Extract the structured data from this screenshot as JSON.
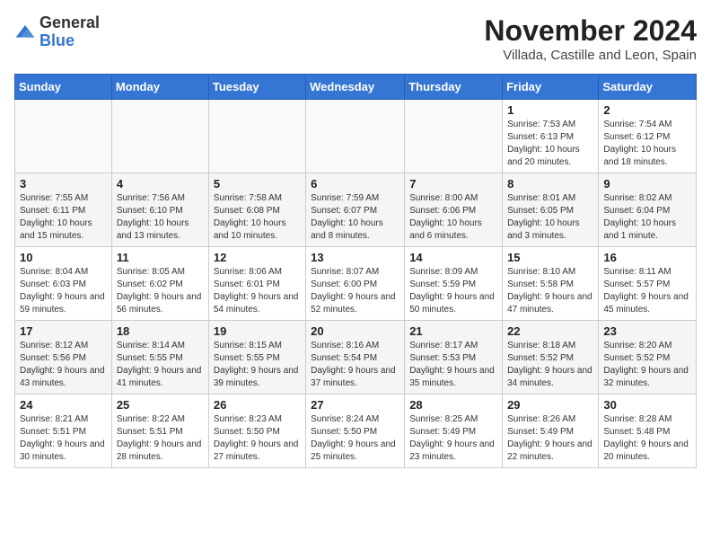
{
  "header": {
    "logo_general": "General",
    "logo_blue": "Blue",
    "month_title": "November 2024",
    "location": "Villada, Castille and Leon, Spain"
  },
  "weekdays": [
    "Sunday",
    "Monday",
    "Tuesday",
    "Wednesday",
    "Thursday",
    "Friday",
    "Saturday"
  ],
  "weeks": [
    [
      {
        "day": "",
        "info": ""
      },
      {
        "day": "",
        "info": ""
      },
      {
        "day": "",
        "info": ""
      },
      {
        "day": "",
        "info": ""
      },
      {
        "day": "",
        "info": ""
      },
      {
        "day": "1",
        "info": "Sunrise: 7:53 AM\nSunset: 6:13 PM\nDaylight: 10 hours and 20 minutes."
      },
      {
        "day": "2",
        "info": "Sunrise: 7:54 AM\nSunset: 6:12 PM\nDaylight: 10 hours and 18 minutes."
      }
    ],
    [
      {
        "day": "3",
        "info": "Sunrise: 7:55 AM\nSunset: 6:11 PM\nDaylight: 10 hours and 15 minutes."
      },
      {
        "day": "4",
        "info": "Sunrise: 7:56 AM\nSunset: 6:10 PM\nDaylight: 10 hours and 13 minutes."
      },
      {
        "day": "5",
        "info": "Sunrise: 7:58 AM\nSunset: 6:08 PM\nDaylight: 10 hours and 10 minutes."
      },
      {
        "day": "6",
        "info": "Sunrise: 7:59 AM\nSunset: 6:07 PM\nDaylight: 10 hours and 8 minutes."
      },
      {
        "day": "7",
        "info": "Sunrise: 8:00 AM\nSunset: 6:06 PM\nDaylight: 10 hours and 6 minutes."
      },
      {
        "day": "8",
        "info": "Sunrise: 8:01 AM\nSunset: 6:05 PM\nDaylight: 10 hours and 3 minutes."
      },
      {
        "day": "9",
        "info": "Sunrise: 8:02 AM\nSunset: 6:04 PM\nDaylight: 10 hours and 1 minute."
      }
    ],
    [
      {
        "day": "10",
        "info": "Sunrise: 8:04 AM\nSunset: 6:03 PM\nDaylight: 9 hours and 59 minutes."
      },
      {
        "day": "11",
        "info": "Sunrise: 8:05 AM\nSunset: 6:02 PM\nDaylight: 9 hours and 56 minutes."
      },
      {
        "day": "12",
        "info": "Sunrise: 8:06 AM\nSunset: 6:01 PM\nDaylight: 9 hours and 54 minutes."
      },
      {
        "day": "13",
        "info": "Sunrise: 8:07 AM\nSunset: 6:00 PM\nDaylight: 9 hours and 52 minutes."
      },
      {
        "day": "14",
        "info": "Sunrise: 8:09 AM\nSunset: 5:59 PM\nDaylight: 9 hours and 50 minutes."
      },
      {
        "day": "15",
        "info": "Sunrise: 8:10 AM\nSunset: 5:58 PM\nDaylight: 9 hours and 47 minutes."
      },
      {
        "day": "16",
        "info": "Sunrise: 8:11 AM\nSunset: 5:57 PM\nDaylight: 9 hours and 45 minutes."
      }
    ],
    [
      {
        "day": "17",
        "info": "Sunrise: 8:12 AM\nSunset: 5:56 PM\nDaylight: 9 hours and 43 minutes."
      },
      {
        "day": "18",
        "info": "Sunrise: 8:14 AM\nSunset: 5:55 PM\nDaylight: 9 hours and 41 minutes."
      },
      {
        "day": "19",
        "info": "Sunrise: 8:15 AM\nSunset: 5:55 PM\nDaylight: 9 hours and 39 minutes."
      },
      {
        "day": "20",
        "info": "Sunrise: 8:16 AM\nSunset: 5:54 PM\nDaylight: 9 hours and 37 minutes."
      },
      {
        "day": "21",
        "info": "Sunrise: 8:17 AM\nSunset: 5:53 PM\nDaylight: 9 hours and 35 minutes."
      },
      {
        "day": "22",
        "info": "Sunrise: 8:18 AM\nSunset: 5:52 PM\nDaylight: 9 hours and 34 minutes."
      },
      {
        "day": "23",
        "info": "Sunrise: 8:20 AM\nSunset: 5:52 PM\nDaylight: 9 hours and 32 minutes."
      }
    ],
    [
      {
        "day": "24",
        "info": "Sunrise: 8:21 AM\nSunset: 5:51 PM\nDaylight: 9 hours and 30 minutes."
      },
      {
        "day": "25",
        "info": "Sunrise: 8:22 AM\nSunset: 5:51 PM\nDaylight: 9 hours and 28 minutes."
      },
      {
        "day": "26",
        "info": "Sunrise: 8:23 AM\nSunset: 5:50 PM\nDaylight: 9 hours and 27 minutes."
      },
      {
        "day": "27",
        "info": "Sunrise: 8:24 AM\nSunset: 5:50 PM\nDaylight: 9 hours and 25 minutes."
      },
      {
        "day": "28",
        "info": "Sunrise: 8:25 AM\nSunset: 5:49 PM\nDaylight: 9 hours and 23 minutes."
      },
      {
        "day": "29",
        "info": "Sunrise: 8:26 AM\nSunset: 5:49 PM\nDaylight: 9 hours and 22 minutes."
      },
      {
        "day": "30",
        "info": "Sunrise: 8:28 AM\nSunset: 5:48 PM\nDaylight: 9 hours and 20 minutes."
      }
    ]
  ]
}
